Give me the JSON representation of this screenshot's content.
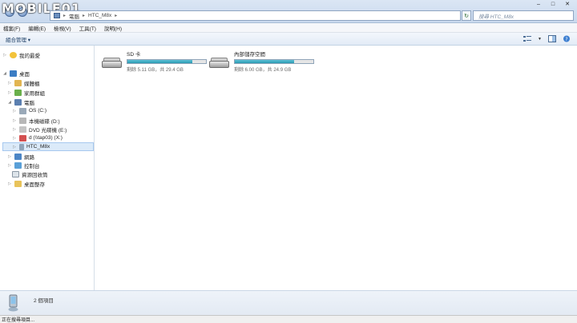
{
  "watermark": {
    "logo_text": "MOBILE01"
  },
  "address_bar": {
    "crumbs": [
      "電腦",
      "HTC_M8x"
    ],
    "search_placeholder": "搜尋 HTC_M8x"
  },
  "window_controls": {
    "minimize": "–",
    "maximize": "□",
    "close": "✕"
  },
  "menu": {
    "items": [
      "檔案(F)",
      "編輯(E)",
      "檢視(V)",
      "工具(T)",
      "說明(H)"
    ]
  },
  "command_bar": {
    "organize_label": "組合管理 ▾"
  },
  "nav_tree": {
    "favorites": "我的最愛",
    "desktop": "桌面",
    "libraries": "媒體櫃",
    "homegroup": "家用群組",
    "computer": "電腦",
    "os_c": "OS (C:)",
    "local_d": "本機磁碟 (D:)",
    "dvd_e": "DVD 光碟機 (E:)",
    "net_x": "d (\\\\tap03) (X:)",
    "htc": "HTC_M8x",
    "network": "網路",
    "control_panel": "控制台",
    "recycle_bin": "資源回收筒",
    "desktop_store": "桌面整存"
  },
  "drives": [
    {
      "name": "SD 卡",
      "free_text": "剩餘 5.11 GB，共 29.4 GB",
      "used_fraction": 0.826
    },
    {
      "name": "內部儲存空間",
      "free_text": "剩餘 6.00 GB，共 24.9 GB",
      "used_fraction": 0.759
    }
  ],
  "details": {
    "item_count": "2 個項目"
  },
  "status": {
    "text": "正在搜尋項目..."
  },
  "colors": {
    "bar_fill": "#2b9ab3",
    "selection": "#dbeaf9"
  }
}
